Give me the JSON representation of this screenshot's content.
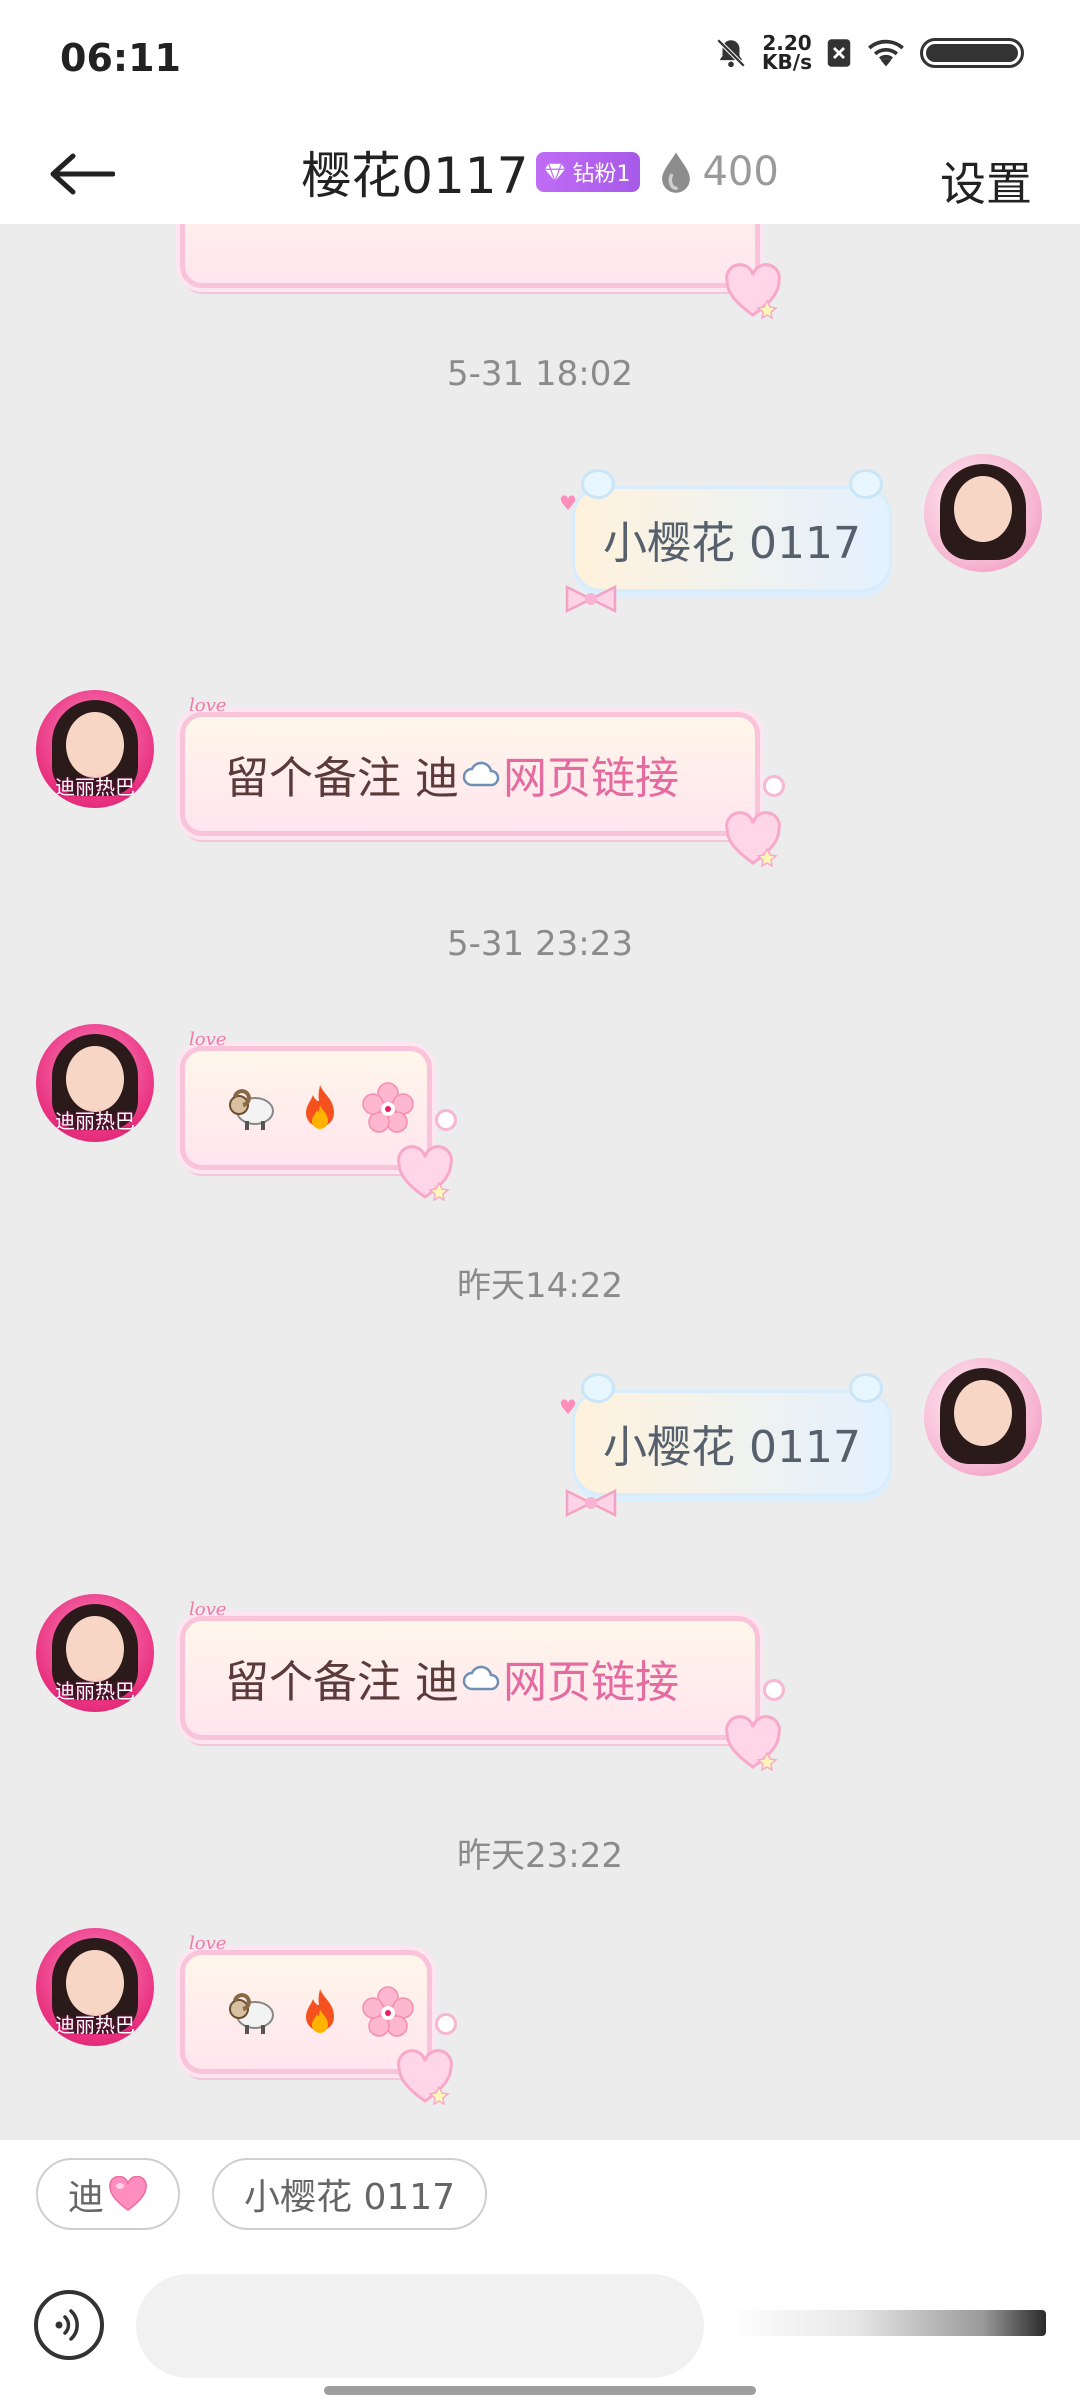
{
  "status_bar": {
    "time": "06:11",
    "net_speed_value": "2.20",
    "net_speed_unit": "KB/s"
  },
  "header": {
    "title": "樱花0117",
    "fan_badge": "钻粉1",
    "fire_count": "400",
    "settings_label": "设置"
  },
  "avatars": {
    "left_caption": "迪丽热巴"
  },
  "chat": {
    "timestamps": [
      "5-31 18:02",
      "5-31 23:23",
      "昨天14:22",
      "昨天23:22"
    ],
    "outgoing": [
      "小樱花 0117",
      "小樱花 0117"
    ],
    "incoming_note": {
      "prefix": "留个备注 迪",
      "link": "网页链接"
    },
    "love_tag": "love",
    "emojis": [
      "ram-emoji",
      "fire-emoji",
      "cherry-blossom-emoji"
    ]
  },
  "quick_replies": [
    "迪",
    "小樱花 0117"
  ],
  "colors": {
    "accent_pink": "#e46aa0",
    "badge_purple": "#b463ef"
  }
}
